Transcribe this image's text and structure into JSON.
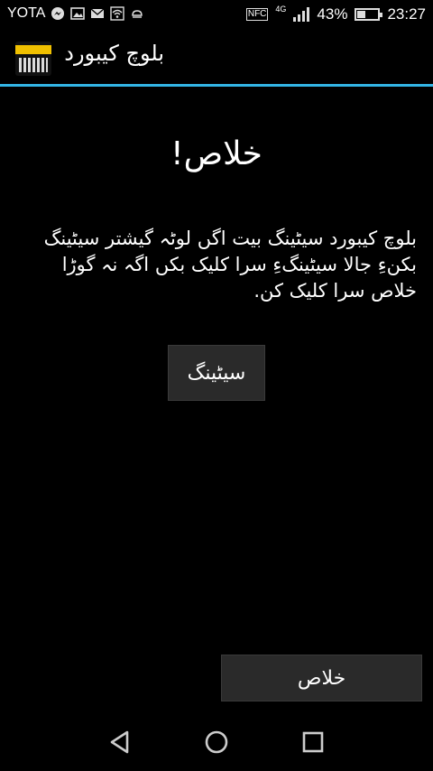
{
  "status_bar": {
    "carrier": "YOTA",
    "battery_percent": "43%",
    "battery_level": 0.43,
    "time": "23:27",
    "nfc_label": "NFC",
    "network_type": "4G",
    "icons": [
      "messenger-icon",
      "image-icon",
      "mail-icon",
      "wifi-icon",
      "android-icon",
      "nfc-icon",
      "signal-icon",
      "battery-icon"
    ]
  },
  "action_bar": {
    "title": "بلوچ کیبورد"
  },
  "main": {
    "heading": "خلاص!",
    "message": "بلوچ کیبورد سیٹینگ بیت اگں لوٹہ گیشتر سیٹینگ بکنءِ جالا سیٹینگءِ سرا کلیک بکں اگہ نہ گوڑا خلاص سرا کلیک کن.",
    "settings_button": "سیٹینگ",
    "done_button": "خلاص"
  },
  "colors": {
    "background": "#000000",
    "accent": "#33b5e5",
    "button_bg": "#2a2a2a"
  }
}
